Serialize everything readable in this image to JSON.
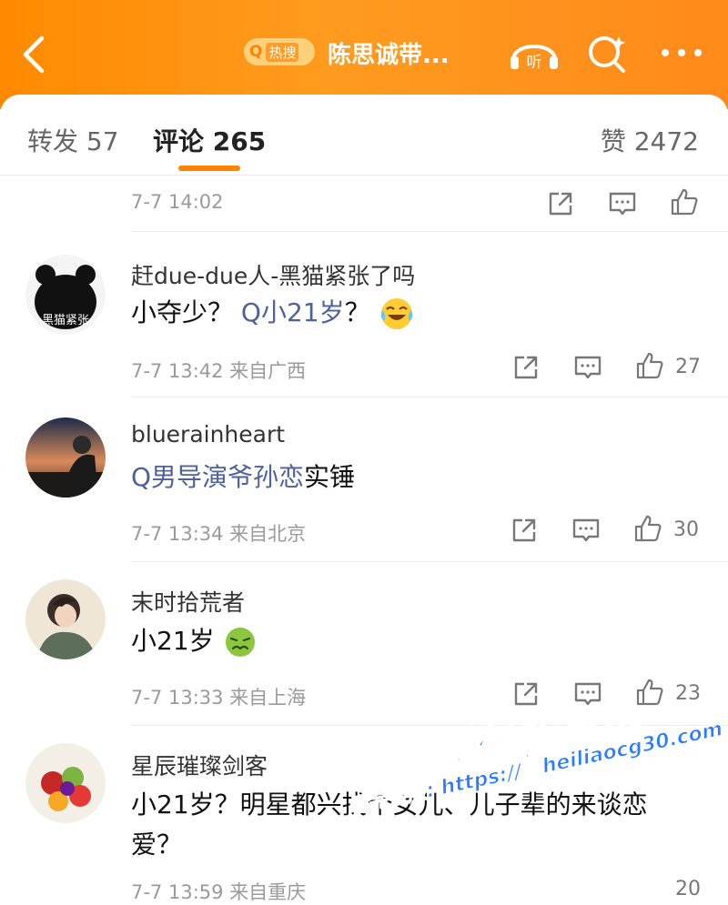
{
  "header": {
    "hot_search_label": "热搜",
    "title": "陈思诚带...",
    "listen_label": "听"
  },
  "tabs": {
    "repost": "转发 57",
    "comment": "评论 265",
    "like": "赞 2472"
  },
  "prev_meta": "7-7 14:02",
  "comments": [
    {
      "username": "赶due-due人-黑猫紧张了吗",
      "avatar_text": "黑猫紧张",
      "text_before": "小夺少？",
      "link": "Q小21岁",
      "text_after": "？",
      "emoji": "laugh-cry",
      "meta": "7-7 13:42 来自广西",
      "likes": "27"
    },
    {
      "username": "bluerainheart",
      "text_before": "",
      "link": "Q男导演爷孙恋",
      "text_after": "实锤",
      "meta": "7-7 13:34 来自北京",
      "likes": "30"
    },
    {
      "username": "末时拾荒者",
      "text_before": "小21岁",
      "link": "",
      "text_after": "",
      "emoji": "sick",
      "meta": "7-7 13:33 来自上海",
      "likes": "23"
    },
    {
      "username": "星辰璀璨剑客",
      "text_line1": "小21岁？明星都兴找个女儿、儿子辈的来谈恋",
      "text_line2": "爱？",
      "meta": "7-7 13:59 来自重庆",
      "likes": "20"
    }
  ],
  "watermark": {
    "brand": "黑料吃瓜网",
    "url_top": "heiliaocg30.com",
    "url_bottom": "看完整版: https://"
  },
  "colors": {
    "header_orange": "#ff8a00",
    "tab_indicator": "#ff8200",
    "link_blue": "#50609c",
    "watermark_blue": "#2b7bff"
  }
}
